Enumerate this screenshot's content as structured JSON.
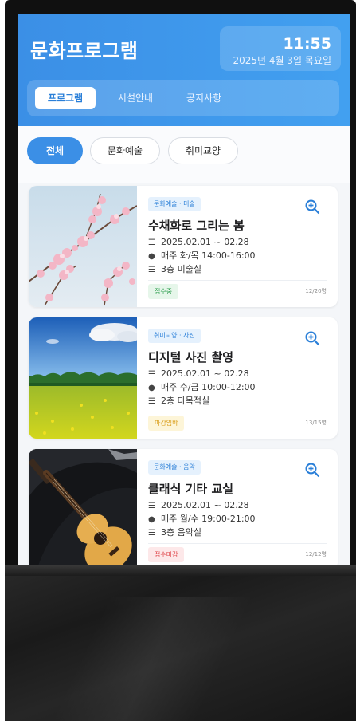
{
  "app": {
    "title": "문화프로그램",
    "time": "11:55",
    "date": "2025년 4월 3일 목요일"
  },
  "nav": {
    "items": [
      {
        "label": "프로그램",
        "active": true
      },
      {
        "label": "시설안내",
        "active": false
      },
      {
        "label": "공지사항",
        "active": false
      }
    ]
  },
  "filters": {
    "chips": [
      {
        "label": "전체",
        "active": true
      },
      {
        "label": "문화예술",
        "active": false
      },
      {
        "label": "취미교양",
        "active": false
      }
    ]
  },
  "programs": [
    {
      "category": "문화예술 · 미술",
      "title": "수채화로 그리는 봄",
      "period": "2025.02.01 ~ 02.28",
      "schedule": "매주 화/목 14:00-16:00",
      "location": "3층 미술실",
      "status": "접수중",
      "status_color": "#2e9e4f",
      "status_bg": "#e6f6ea",
      "capacity": "12/20명",
      "image": "cherry-blossom"
    },
    {
      "category": "취미교양 · 사진",
      "title": "디지털 사진 촬영",
      "period": "2025.02.01 ~ 02.28",
      "schedule": "매주 수/금 10:00-12:00",
      "location": "2층 다목적실",
      "status": "마감임박",
      "status_color": "#d89a12",
      "status_bg": "#fdf5d8",
      "capacity": "13/15명",
      "image": "field-landscape"
    },
    {
      "category": "문화예술 · 음악",
      "title": "클래식 기타 교실",
      "period": "2025.02.01 ~ 02.28",
      "schedule": "매주 월/수 19:00-21:00",
      "location": "3층 음악실",
      "status": "접수마감",
      "status_color": "#e0474c",
      "status_bg": "#fde8e9",
      "capacity": "12/12명",
      "image": "classical-guitar"
    }
  ],
  "icons": {
    "period": "list-icon",
    "schedule": "clock-icon",
    "location": "building-icon",
    "zoom": "zoom-in-icon"
  },
  "colors": {
    "accent": "#3b8fe6",
    "background": "#f4f6f9"
  }
}
